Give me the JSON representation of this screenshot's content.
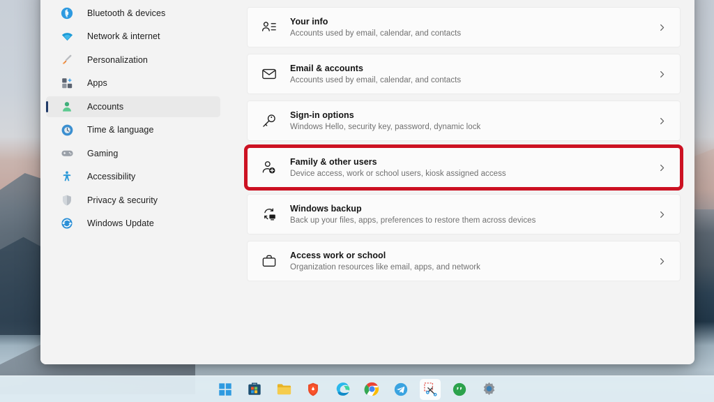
{
  "window": {
    "app": "Settings"
  },
  "sidebar": {
    "items": [
      {
        "label": "Bluetooth & devices",
        "icon": "bluetooth-icon",
        "selected": false
      },
      {
        "label": "Network & internet",
        "icon": "wifi-icon",
        "selected": false
      },
      {
        "label": "Personalization",
        "icon": "paintbrush-icon",
        "selected": false
      },
      {
        "label": "Apps",
        "icon": "apps-icon",
        "selected": false
      },
      {
        "label": "Accounts",
        "icon": "person-icon",
        "selected": true
      },
      {
        "label": "Time & language",
        "icon": "clock-globe-icon",
        "selected": false
      },
      {
        "label": "Gaming",
        "icon": "gamepad-icon",
        "selected": false
      },
      {
        "label": "Accessibility",
        "icon": "accessibility-icon",
        "selected": false
      },
      {
        "label": "Privacy & security",
        "icon": "shield-icon",
        "selected": false
      },
      {
        "label": "Windows Update",
        "icon": "update-icon",
        "selected": false
      }
    ]
  },
  "main": {
    "cards": [
      {
        "title": "Your info",
        "subtitle": "Accounts used by email, calendar, and contacts",
        "icon": "person-details-icon",
        "highlighted": false
      },
      {
        "title": "Email & accounts",
        "subtitle": "Accounts used by email, calendar, and contacts",
        "icon": "envelope-icon",
        "highlighted": false
      },
      {
        "title": "Sign-in options",
        "subtitle": "Windows Hello, security key, password, dynamic lock",
        "icon": "key-icon",
        "highlighted": false
      },
      {
        "title": "Family & other users",
        "subtitle": "Device access, work or school users, kiosk assigned access",
        "icon": "person-add-icon",
        "highlighted": true
      },
      {
        "title": "Windows backup",
        "subtitle": "Back up your files, apps, preferences to restore them across devices",
        "icon": "backup-icon",
        "highlighted": false
      },
      {
        "title": "Access work or school",
        "subtitle": "Organization resources like email, apps, and network",
        "icon": "briefcase-icon",
        "highlighted": false
      }
    ],
    "chevron": "chevron-right-icon"
  },
  "taskbar": {
    "items": [
      {
        "name": "start-button",
        "icon": "windows-start-icon",
        "active": false
      },
      {
        "name": "microsoft-store",
        "icon": "store-icon",
        "active": false
      },
      {
        "name": "file-explorer",
        "icon": "folder-icon",
        "active": false
      },
      {
        "name": "brave-browser",
        "icon": "brave-icon",
        "active": false
      },
      {
        "name": "microsoft-edge",
        "icon": "edge-icon",
        "active": false
      },
      {
        "name": "google-chrome",
        "icon": "chrome-icon",
        "active": false
      },
      {
        "name": "telegram",
        "icon": "telegram-icon",
        "active": false
      },
      {
        "name": "snipping-tool",
        "icon": "snipping-tool-icon",
        "active": true
      },
      {
        "name": "chat-app",
        "icon": "chat-bubble-icon",
        "active": false
      },
      {
        "name": "settings",
        "icon": "gear-icon",
        "active": false
      }
    ]
  },
  "colors": {
    "highlight_red": "#cc1122",
    "selection_indicator": "#203a68",
    "accent_blue": "#0078d4"
  }
}
